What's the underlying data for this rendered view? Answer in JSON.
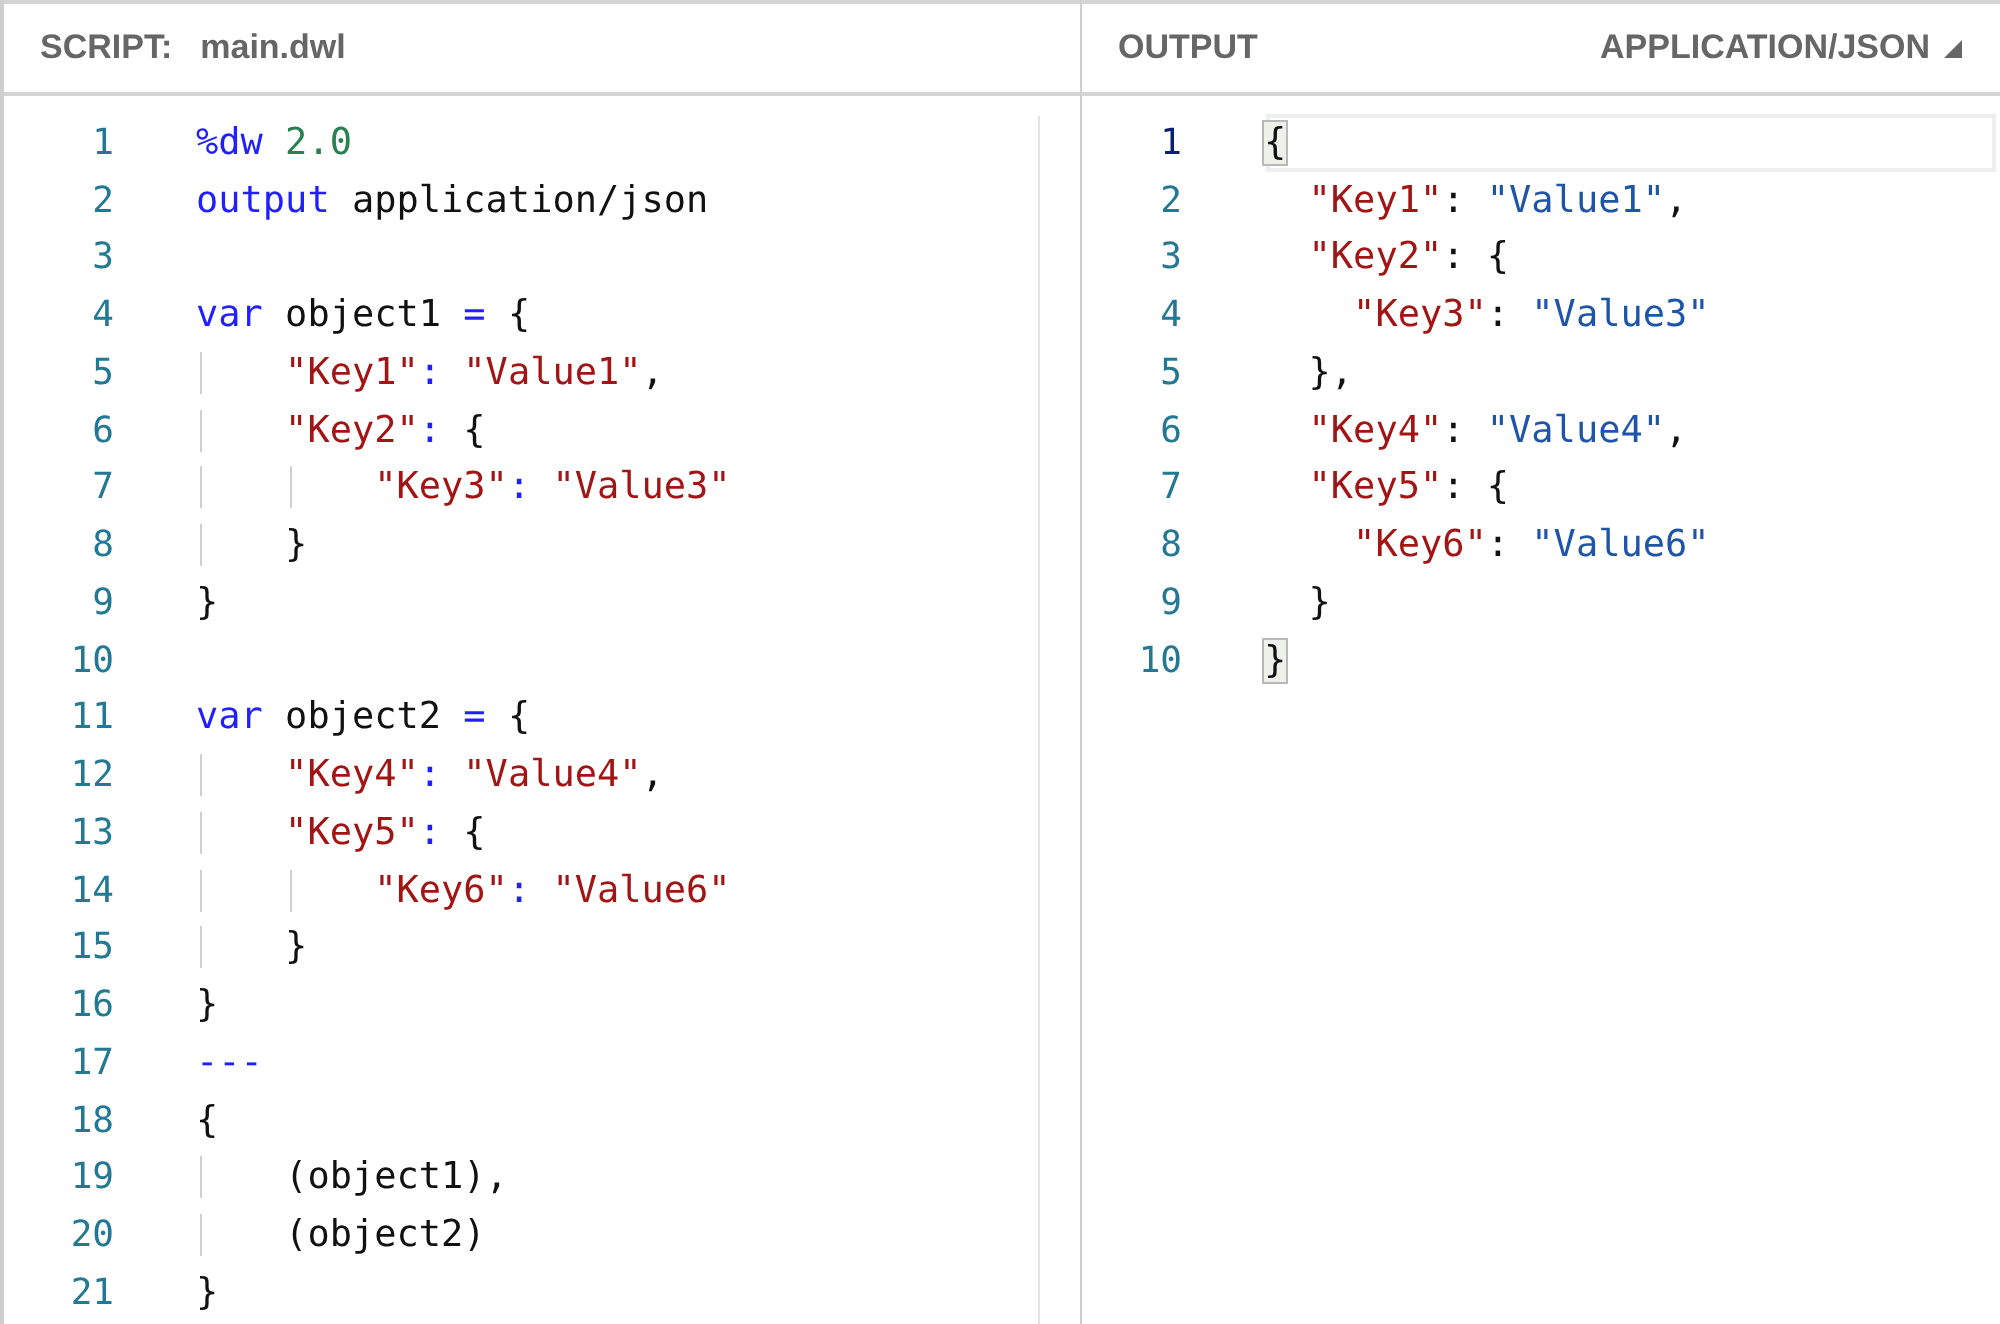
{
  "script_panel": {
    "label": "SCRIPT:",
    "filename": "main.dwl",
    "lines": [
      {
        "number": "1",
        "tokens": [
          {
            "kind": "keyword",
            "text": "%dw"
          },
          {
            "kind": "number",
            "text": " 2.0"
          }
        ]
      },
      {
        "number": "2",
        "tokens": [
          {
            "kind": "keyword",
            "text": "output"
          },
          {
            "kind": "plain",
            "text": " application/json"
          }
        ]
      },
      {
        "number": "3"
      },
      {
        "number": "4",
        "tokens": [
          {
            "kind": "keyword",
            "text": "var"
          },
          {
            "kind": "plain",
            "text": " object1 "
          },
          {
            "kind": "keyword",
            "text": "="
          },
          {
            "kind": "plain",
            "text": " {"
          }
        ]
      },
      {
        "number": "5",
        "tokens": [
          {
            "kind": "string",
            "text": "    \"Key1\""
          },
          {
            "kind": "keyword",
            "text": ":"
          },
          {
            "kind": "string",
            "text": " \"Value1\""
          },
          {
            "kind": "plain",
            "text": ","
          }
        ]
      },
      {
        "number": "6",
        "tokens": [
          {
            "kind": "string",
            "text": "    \"Key2\""
          },
          {
            "kind": "keyword",
            "text": ":"
          },
          {
            "kind": "plain",
            "text": " {"
          }
        ]
      },
      {
        "number": "7",
        "tokens": [
          {
            "kind": "string",
            "text": "        \"Key3\""
          },
          {
            "kind": "keyword",
            "text": ":"
          },
          {
            "kind": "string",
            "text": " \"Value3\""
          }
        ]
      },
      {
        "number": "8",
        "tokens": [
          {
            "kind": "plain",
            "text": "    }"
          }
        ]
      },
      {
        "number": "9",
        "tokens": [
          {
            "kind": "plain",
            "text": "}"
          }
        ]
      },
      {
        "number": "10"
      },
      {
        "number": "11",
        "tokens": [
          {
            "kind": "keyword",
            "text": "var"
          },
          {
            "kind": "plain",
            "text": " object2 "
          },
          {
            "kind": "keyword",
            "text": "="
          },
          {
            "kind": "plain",
            "text": " {"
          }
        ]
      },
      {
        "number": "12",
        "tokens": [
          {
            "kind": "string",
            "text": "    \"Key4\""
          },
          {
            "kind": "keyword",
            "text": ":"
          },
          {
            "kind": "string",
            "text": " \"Value4\""
          },
          {
            "kind": "plain",
            "text": ","
          }
        ]
      },
      {
        "number": "13",
        "tokens": [
          {
            "kind": "string",
            "text": "    \"Key5\""
          },
          {
            "kind": "keyword",
            "text": ":"
          },
          {
            "kind": "plain",
            "text": " {"
          }
        ]
      },
      {
        "number": "14",
        "tokens": [
          {
            "kind": "string",
            "text": "        \"Key6\""
          },
          {
            "kind": "keyword",
            "text": ":"
          },
          {
            "kind": "string",
            "text": " \"Value6\""
          }
        ]
      },
      {
        "number": "15",
        "tokens": [
          {
            "kind": "plain",
            "text": "    }"
          }
        ]
      },
      {
        "number": "16",
        "tokens": [
          {
            "kind": "plain",
            "text": "}"
          }
        ]
      },
      {
        "number": "17",
        "tokens": [
          {
            "kind": "keyword",
            "text": "---"
          }
        ]
      },
      {
        "number": "18",
        "tokens": [
          {
            "kind": "plain",
            "text": "{"
          }
        ]
      },
      {
        "number": "19",
        "tokens": [
          {
            "kind": "plain",
            "text": "    (object1),"
          }
        ]
      },
      {
        "number": "20",
        "tokens": [
          {
            "kind": "plain",
            "text": "    (object2)"
          }
        ]
      },
      {
        "number": "21",
        "tokens": [
          {
            "kind": "plain",
            "text": "}"
          }
        ]
      }
    ]
  },
  "output_panel": {
    "label": "OUTPUT",
    "format": "APPLICATION/JSON",
    "lines": [
      {
        "number": "1",
        "selected": true,
        "tokens": [
          {
            "kind": "matched",
            "text": "{"
          }
        ]
      },
      {
        "number": "2",
        "selected": false,
        "tokens": [
          {
            "kind": "key",
            "text": "  \"Key1\""
          },
          {
            "kind": "plain",
            "text": ": "
          },
          {
            "kind": "value",
            "text": "\"Value1\""
          },
          {
            "kind": "plain",
            "text": ","
          }
        ]
      },
      {
        "number": "3",
        "selected": false,
        "tokens": [
          {
            "kind": "key",
            "text": "  \"Key2\""
          },
          {
            "kind": "plain",
            "text": ": {"
          }
        ]
      },
      {
        "number": "4",
        "selected": false,
        "tokens": [
          {
            "kind": "key",
            "text": "    \"Key3\""
          },
          {
            "kind": "plain",
            "text": ": "
          },
          {
            "kind": "value",
            "text": "\"Value3\""
          }
        ]
      },
      {
        "number": "5",
        "selected": false,
        "tokens": [
          {
            "kind": "plain",
            "text": "  },"
          }
        ]
      },
      {
        "number": "6",
        "selected": false,
        "tokens": [
          {
            "kind": "key",
            "text": "  \"Key4\""
          },
          {
            "kind": "plain",
            "text": ": "
          },
          {
            "kind": "value",
            "text": "\"Value4\""
          },
          {
            "kind": "plain",
            "text": ","
          }
        ]
      },
      {
        "number": "7",
        "selected": false,
        "tokens": [
          {
            "kind": "key",
            "text": "  \"Key5\""
          },
          {
            "kind": "plain",
            "text": ": {"
          }
        ]
      },
      {
        "number": "8",
        "selected": false,
        "tokens": [
          {
            "kind": "key",
            "text": "    \"Key6\""
          },
          {
            "kind": "plain",
            "text": ": "
          },
          {
            "kind": "value",
            "text": "\"Value6\""
          }
        ]
      },
      {
        "number": "9",
        "selected": false,
        "tokens": [
          {
            "kind": "plain",
            "text": "  }"
          }
        ]
      },
      {
        "number": "10",
        "selected": false,
        "tokens": [
          {
            "kind": "matched",
            "text": "}"
          }
        ]
      }
    ]
  }
}
